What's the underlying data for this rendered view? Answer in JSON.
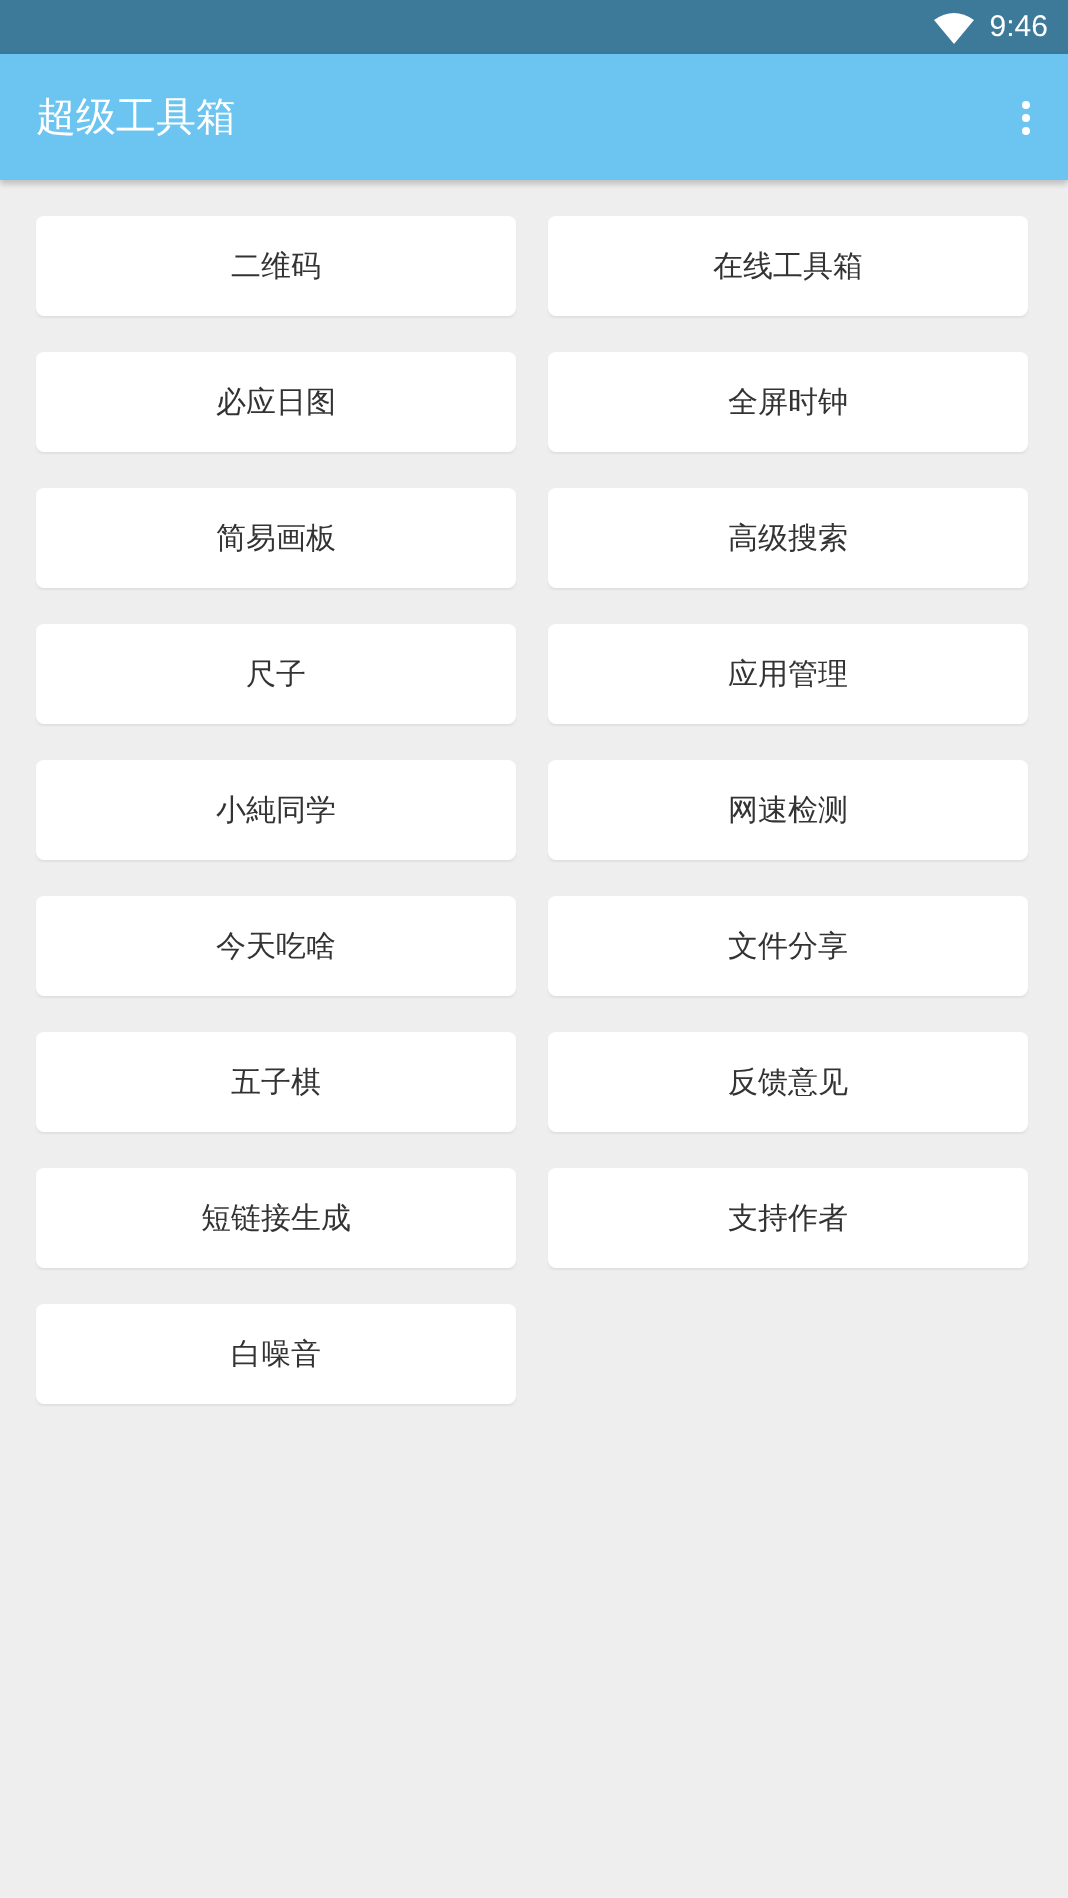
{
  "status_bar": {
    "time": "9:46"
  },
  "app_bar": {
    "title": "超级工具箱"
  },
  "tools": [
    {
      "label": "二维码"
    },
    {
      "label": "在线工具箱"
    },
    {
      "label": "必应日图"
    },
    {
      "label": "全屏时钟"
    },
    {
      "label": "简易画板"
    },
    {
      "label": "高级搜索"
    },
    {
      "label": "尺子"
    },
    {
      "label": "应用管理"
    },
    {
      "label": "小純同学"
    },
    {
      "label": "网速检测"
    },
    {
      "label": "今天吃啥"
    },
    {
      "label": "文件分享"
    },
    {
      "label": "五子棋"
    },
    {
      "label": "反馈意见"
    },
    {
      "label": "短链接生成"
    },
    {
      "label": "支持作者"
    },
    {
      "label": "白噪音"
    }
  ]
}
